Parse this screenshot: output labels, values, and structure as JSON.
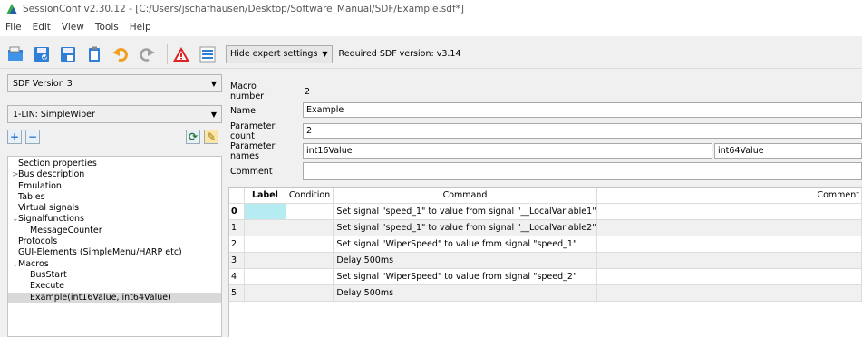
{
  "window": {
    "title": "SessionConf v2.30.12 - [C:/Users/jschafhausen/Desktop/Software_Manual/SDF/Example.sdf*]"
  },
  "menu": [
    "File",
    "Edit",
    "View",
    "Tools",
    "Help"
  ],
  "toolbar": {
    "icons": [
      "open-folder-icon",
      "save-icon",
      "save-as-icon",
      "clipboard-icon",
      "undo-icon",
      "redo-icon",
      "warning-icon",
      "list-icon"
    ],
    "expert_label": "Hide expert settings",
    "required_version": "Required SDF version: v3.14"
  },
  "left": {
    "sdf_version": "SDF Version 3",
    "device": "1-LIN: SimpleWiper",
    "tree": [
      {
        "label": "Section properties",
        "level": 0,
        "expander": ""
      },
      {
        "label": "Bus description",
        "level": 0,
        "expander": ">"
      },
      {
        "label": "Emulation",
        "level": 0,
        "expander": ""
      },
      {
        "label": "Tables",
        "level": 0,
        "expander": ""
      },
      {
        "label": "Virtual signals",
        "level": 0,
        "expander": ""
      },
      {
        "label": "Signalfunctions",
        "level": 0,
        "expander": "v"
      },
      {
        "label": "MessageCounter",
        "level": 1,
        "expander": ""
      },
      {
        "label": "Protocols",
        "level": 0,
        "expander": ""
      },
      {
        "label": "GUI-Elements (SimpleMenu/HARP etc)",
        "level": 0,
        "expander": ""
      },
      {
        "label": "Macros",
        "level": 0,
        "expander": "v"
      },
      {
        "label": "BusStart",
        "level": 1,
        "expander": ""
      },
      {
        "label": "Execute",
        "level": 1,
        "expander": ""
      },
      {
        "label": "Example(int16Value, int64Value)",
        "level": 1,
        "expander": "",
        "selected": true
      }
    ]
  },
  "form": {
    "macro_number_label": "Macro number",
    "macro_number": "2",
    "name_label": "Name",
    "name": "Example",
    "param_count_label": "Parameter count",
    "param_count": "2",
    "param_names_label": "Parameter names",
    "param1": "int16Value",
    "param2": "int64Value",
    "comment_label": "Comment",
    "comment": ""
  },
  "grid": {
    "headers": {
      "label": "Label",
      "condition": "Condition",
      "command": "Command",
      "comment": "Comment"
    },
    "rows": [
      {
        "n": "0",
        "label": "",
        "condition": "",
        "command": "Set signal \"speed_1\" to value from signal \"__LocalVariable1\"",
        "comment": ""
      },
      {
        "n": "1",
        "label": "",
        "condition": "",
        "command": "Set signal \"speed_1\" to value from signal \"__LocalVariable2\"",
        "comment": ""
      },
      {
        "n": "2",
        "label": "",
        "condition": "",
        "command": "Set signal \"WiperSpeed\" to value from signal \"speed_1\"",
        "comment": ""
      },
      {
        "n": "3",
        "label": "",
        "condition": "",
        "command": "Delay 500ms",
        "comment": ""
      },
      {
        "n": "4",
        "label": "",
        "condition": "",
        "command": "Set signal \"WiperSpeed\" to value from signal \"speed_2\"",
        "comment": ""
      },
      {
        "n": "5",
        "label": "",
        "condition": "",
        "command": "Delay 500ms",
        "comment": ""
      }
    ]
  },
  "colors": {
    "selected_cell": "#b5ecf2",
    "alt_row": "#f0f0f0"
  }
}
